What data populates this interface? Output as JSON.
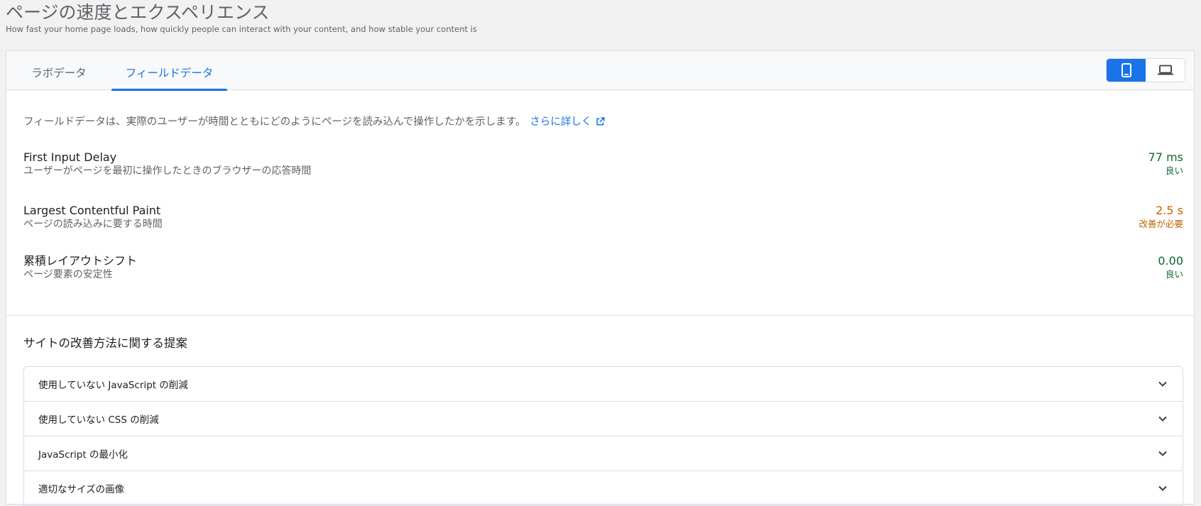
{
  "header": {
    "title": "ページの速度とエクスペリエンス",
    "subtitle": "How fast your home page loads, how quickly people can interact with your content, and how stable your content is"
  },
  "tabs": {
    "lab": "ラボデータ",
    "field": "フィールドデータ",
    "active": "field"
  },
  "device_toggle": {
    "selected": "mobile",
    "icons": [
      "phone-icon",
      "laptop-icon"
    ]
  },
  "intro": {
    "text": "フィールドデータは、実際のユーザーが時間とともにどのようにページを読み込んで操作したかを示します。",
    "link": "さらに詳しく"
  },
  "metrics": [
    {
      "name": "First Input Delay",
      "desc": "ユーザーがページを最初に操作したときのブラウザーの応答時間",
      "value": "77 ms",
      "rating": "良い",
      "status": "good"
    },
    {
      "name": "Largest Contentful Paint",
      "desc": "ページの読み込みに要する時間",
      "value": "2.5 s",
      "rating": "改善が必要",
      "status": "needs-improvement"
    },
    {
      "name": "累積レイアウトシフト",
      "desc": "ページ要素の安定性",
      "value": "0.00",
      "rating": "良い",
      "status": "good"
    }
  ],
  "suggestions": {
    "title": "サイトの改善方法に関する提案",
    "items": [
      "使用していない JavaScript の削減",
      "使用していない CSS の削減",
      "JavaScript の最小化",
      "適切なサイズの画像"
    ]
  },
  "colors": {
    "accent": "#1a73e8",
    "good": "#0d652d",
    "needs_improvement": "#c26401"
  }
}
